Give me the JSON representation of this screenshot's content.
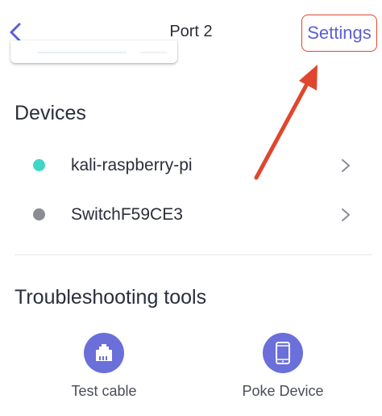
{
  "header": {
    "title": "Port 2",
    "settings_label": "Settings"
  },
  "devices": {
    "heading": "Devices",
    "items": [
      {
        "name": "kali-raspberry-pi",
        "status_color": "#3fd6c8"
      },
      {
        "name": "SwitchF59CE3",
        "status_color": "#8a8d94"
      }
    ]
  },
  "troubleshooting": {
    "heading": "Troubleshooting tools",
    "tools": [
      {
        "label": "Test cable",
        "icon": "ethernet-port-icon"
      },
      {
        "label": "Poke Device",
        "icon": "smartphone-icon"
      }
    ]
  },
  "colors": {
    "accent": "#5b5fd4",
    "tool_circle": "#6a6fd9",
    "annotation": "#e0462f"
  }
}
